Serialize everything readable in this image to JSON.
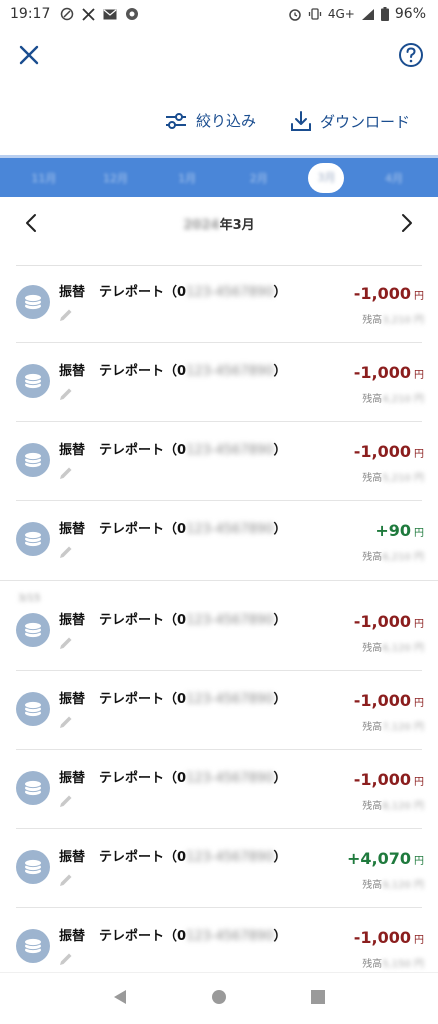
{
  "status_bar": {
    "time": "19:17",
    "network": "4G+",
    "battery": "96%"
  },
  "actions": {
    "filter_label": "絞り込み",
    "download_label": "ダウンロード"
  },
  "month_tabs": [
    "11月",
    "12月",
    "1月",
    "2月",
    "3月",
    "4月"
  ],
  "month_nav": {
    "year_blurred": "2024",
    "month_suffix": "年3月"
  },
  "transactions": [
    {
      "type": "振替",
      "name": "テレポート（0",
      "account_blurred": "123-4567890",
      "amount": "-1,000",
      "sign": "neg",
      "yen": "円",
      "balance_label": "残高",
      "balance_blurred": "3,210 円"
    },
    {
      "type": "振替",
      "name": "テレポート（0",
      "account_blurred": "123-4567890",
      "amount": "-1,000",
      "sign": "neg",
      "yen": "円",
      "balance_label": "残高",
      "balance_blurred": "4,210 円"
    },
    {
      "type": "振替",
      "name": "テレポート（0",
      "account_blurred": "123-4567890",
      "amount": "-1,000",
      "sign": "neg",
      "yen": "円",
      "balance_label": "残高",
      "balance_blurred": "5,210 円"
    },
    {
      "type": "振替",
      "name": "テレポート（0",
      "account_blurred": "123-4567890",
      "amount": "+90",
      "sign": "pos",
      "yen": "円",
      "balance_label": "残高",
      "balance_blurred": "6,210 円"
    },
    {
      "type": "振替",
      "name": "テレポート（0",
      "account_blurred": "123-4567890",
      "amount": "-1,000",
      "sign": "neg",
      "yen": "円",
      "balance_label": "残高",
      "balance_blurred": "6,120 円"
    },
    {
      "type": "振替",
      "name": "テレポート（0",
      "account_blurred": "123-4567890",
      "amount": "-1,000",
      "sign": "neg",
      "yen": "円",
      "balance_label": "残高",
      "balance_blurred": "7,120 円"
    },
    {
      "type": "振替",
      "name": "テレポート（0",
      "account_blurred": "123-4567890",
      "amount": "-1,000",
      "sign": "neg",
      "yen": "円",
      "balance_label": "残高",
      "balance_blurred": "8,120 円"
    },
    {
      "type": "振替",
      "name": "テレポート（0",
      "account_blurred": "123-4567890",
      "amount": "+4,070",
      "sign": "pos",
      "yen": "円",
      "balance_label": "残高",
      "balance_blurred": "9,120 円"
    },
    {
      "type": "振替",
      "name": "テレポート（0",
      "account_blurred": "123-4567890",
      "amount": "-1,000",
      "sign": "neg",
      "yen": "円",
      "balance_label": "残高",
      "balance_blurred": "5,150 円"
    }
  ],
  "section_date_blurred": "3/15",
  "colors": {
    "accent": "#1a4d8f",
    "tab_bar": "#4a86d8",
    "negative": "#8b1e1e",
    "positive": "#1f7a3d",
    "avatar": "#9db4cf"
  }
}
